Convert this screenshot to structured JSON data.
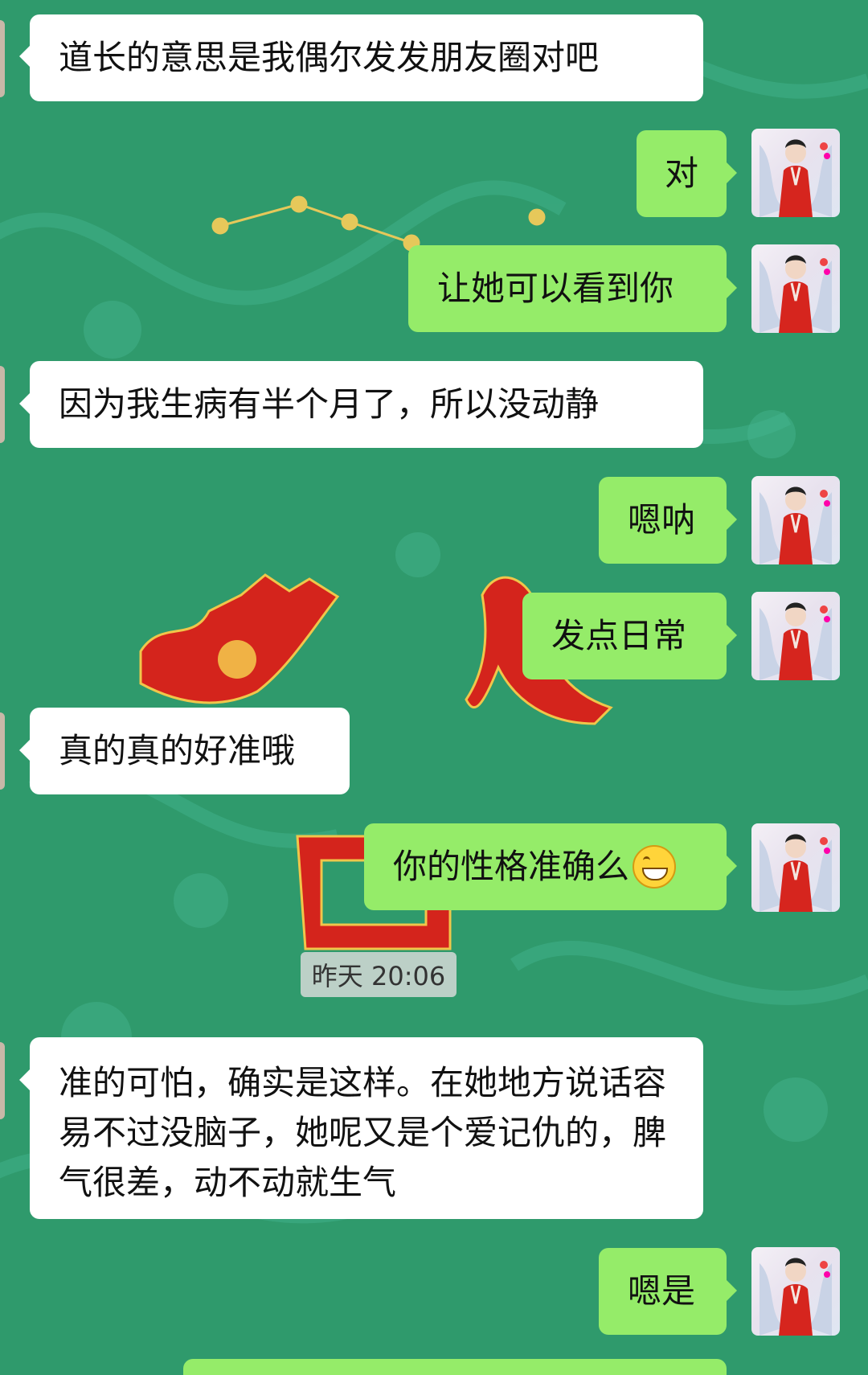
{
  "chat": {
    "messages": [
      {
        "side": "received",
        "text": "道长的意思是我偶尔发发朋友圈对吧"
      },
      {
        "side": "sent",
        "text": "对"
      },
      {
        "side": "sent",
        "text": "让她可以看到你"
      },
      {
        "side": "received",
        "text": "因为我生病有半个月了，所以没动静"
      },
      {
        "side": "sent",
        "text": "嗯呐"
      },
      {
        "side": "sent",
        "text": "发点日常"
      },
      {
        "side": "received",
        "text": "真的真的好准哦"
      },
      {
        "side": "sent",
        "text": "你的性格准确么"
      },
      {
        "side": "received",
        "text": "准的可怕，确实是这样。在她地方说话容易不过没脑子，她呢又是个爱记仇的，脾气很差，动不动就生气"
      },
      {
        "side": "sent",
        "text": "嗯是"
      }
    ],
    "timestamp": "昨天 20:06",
    "emoji": "grinning-face-icon"
  },
  "theme": {
    "background": "#2f9a6c",
    "sent_bubble": "#95ec69",
    "received_bubble": "#ffffff"
  }
}
